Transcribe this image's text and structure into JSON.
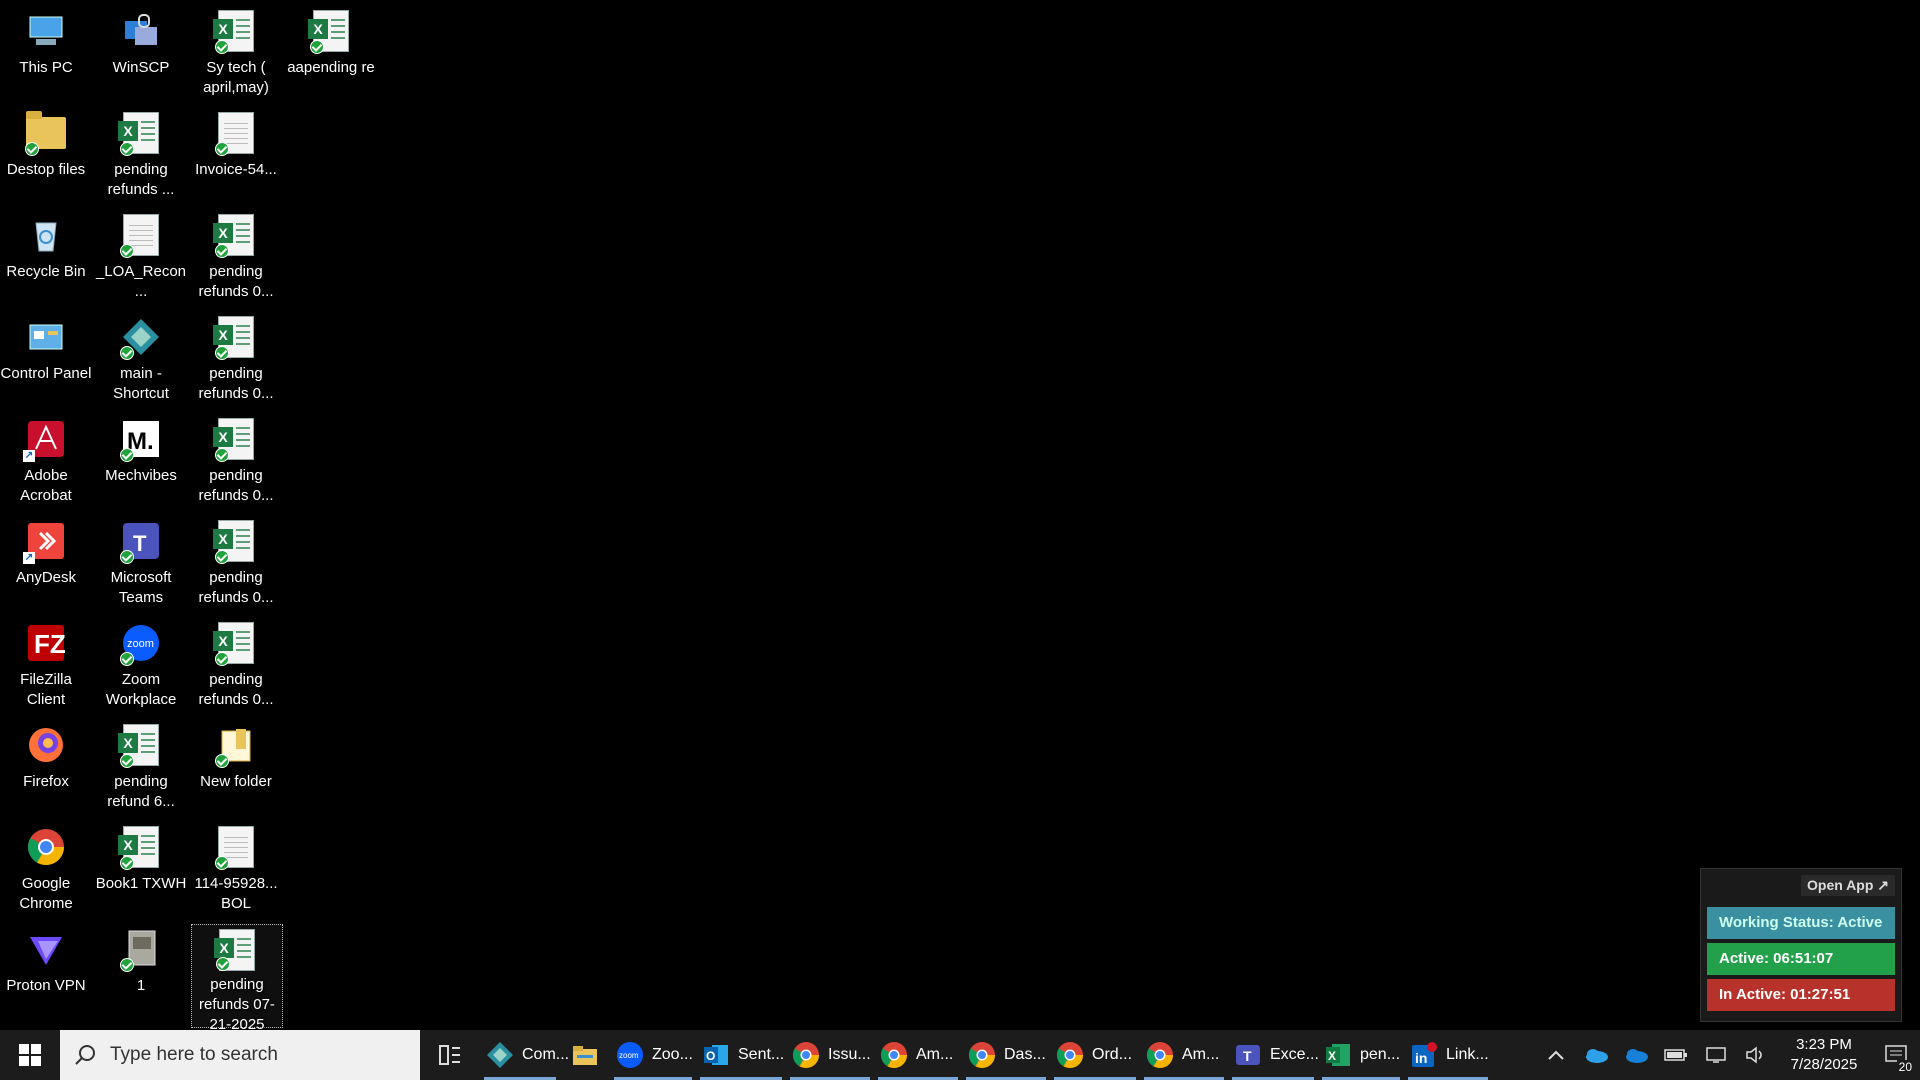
{
  "desktop": {
    "icons": [
      {
        "label": "This PC"
      },
      {
        "label": "Destop files"
      },
      {
        "label": "Recycle Bin"
      },
      {
        "label": "Control Panel"
      },
      {
        "label": "Adobe Acrobat"
      },
      {
        "label": "AnyDesk"
      },
      {
        "label": "FileZilla Client"
      },
      {
        "label": "Firefox"
      },
      {
        "label": "Google Chrome"
      },
      {
        "label": "Proton VPN"
      },
      {
        "label": "WinSCP"
      },
      {
        "label": "pending refunds ..."
      },
      {
        "label": "_LOA_Recon..."
      },
      {
        "label": "main - Shortcut"
      },
      {
        "label": "Mechvibes"
      },
      {
        "label": "Microsoft Teams"
      },
      {
        "label": "Zoom Workplace"
      },
      {
        "label": "pending refund 6..."
      },
      {
        "label": "Book1 TXWH"
      },
      {
        "label": "1"
      },
      {
        "label": "Sy tech ( april,may)"
      },
      {
        "label": "Invoice-54..."
      },
      {
        "label": "pending refunds 0..."
      },
      {
        "label": "pending refunds 0..."
      },
      {
        "label": "pending refunds 0..."
      },
      {
        "label": "pending refunds 0..."
      },
      {
        "label": "pending refunds 0..."
      },
      {
        "label": "New folder"
      },
      {
        "label": "114-95928... BOL"
      },
      {
        "label": "pending refunds 07-21-2025"
      },
      {
        "label": "aapending re"
      }
    ]
  },
  "widget": {
    "open_app": "Open App ↗",
    "working_status": "Working Status: Active",
    "active_time": "Active: 06:51:07",
    "inactive_time": "In Active: 01:27:51",
    "colors": {
      "status": "#3a8fa0",
      "active": "#22a04a",
      "inactive": "#b8322c"
    }
  },
  "taskbar": {
    "search_placeholder": "Type here to search",
    "apps": [
      {
        "label": "Com...",
        "icon": "diamond-app-icon"
      },
      {
        "label": "",
        "icon": "file-explorer-icon"
      },
      {
        "label": "Zoo...",
        "icon": "zoom-icon"
      },
      {
        "label": "Sent...",
        "icon": "outlook-icon"
      },
      {
        "label": "Issu...",
        "icon": "chrome-icon"
      },
      {
        "label": "Am...",
        "icon": "chrome-icon"
      },
      {
        "label": "Das...",
        "icon": "chrome-icon"
      },
      {
        "label": "Ord...",
        "icon": "chrome-icon"
      },
      {
        "label": "Am...",
        "icon": "chrome-icon"
      },
      {
        "label": "Exce...",
        "icon": "teams-icon"
      },
      {
        "label": "pen...",
        "icon": "excel-icon"
      },
      {
        "label": "Link...",
        "icon": "linkedin-icon"
      }
    ],
    "clock_time": "3:23 PM",
    "clock_date": "7/28/2025",
    "notification_count": "20"
  }
}
